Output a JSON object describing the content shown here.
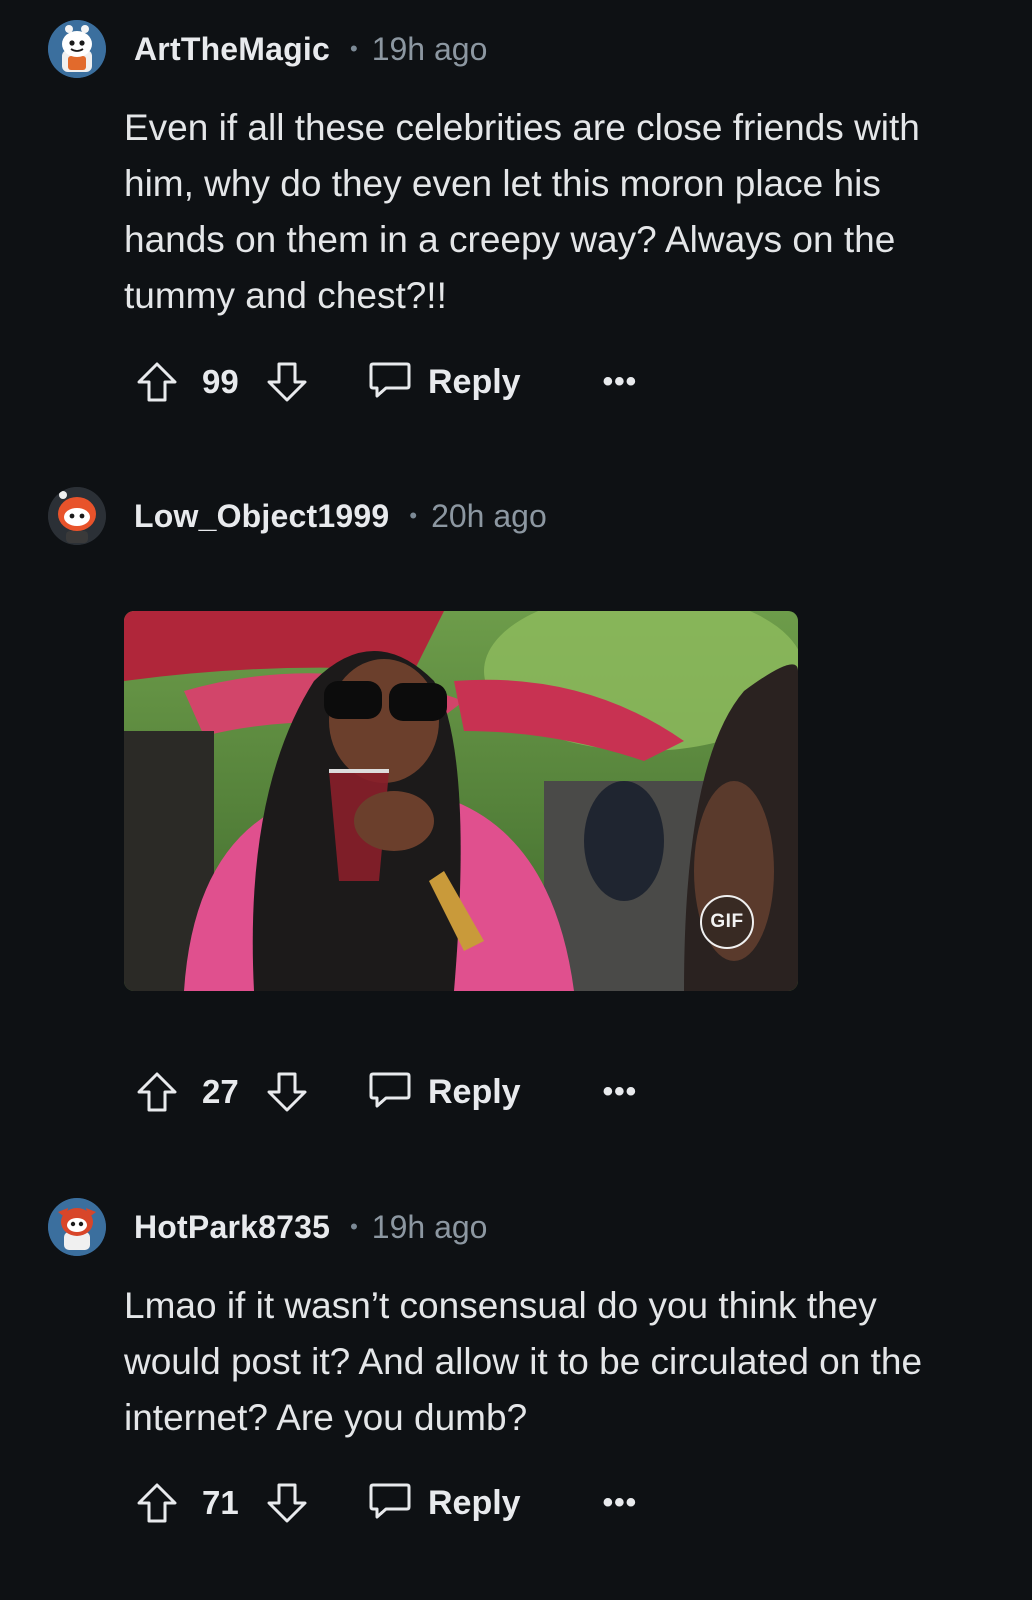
{
  "comments": [
    {
      "username": "ArtTheMagic",
      "separator": "•",
      "time": "19h ago",
      "body": "Even if all these celebrities are close friends with him, why do they even let this moron place his hands on them in a creepy way? Always on the tummy and chest?!!",
      "score": "99",
      "reply_label": "Reply",
      "more_label": "•••",
      "avatar_color": "#4a7fb0"
    },
    {
      "username": "Low_Object1999",
      "separator": "•",
      "time": "20h ago",
      "gif_badge": "GIF",
      "score": "27",
      "reply_label": "Reply",
      "more_label": "•••",
      "avatar_color": "#e2542a"
    },
    {
      "username": "HotPark8735",
      "separator": "•",
      "time": "19h ago",
      "body": "Lmao if it wasn’t consensual do you think they would post it? And allow it to be circulated on the internet? Are you dumb?",
      "score": "71",
      "reply_label": "Reply",
      "more_label": "•••",
      "avatar_color": "#d8462a"
    }
  ],
  "colors": {
    "background": "#0e1114",
    "text": "#e4e6e8",
    "muted": "#8c97a1"
  }
}
